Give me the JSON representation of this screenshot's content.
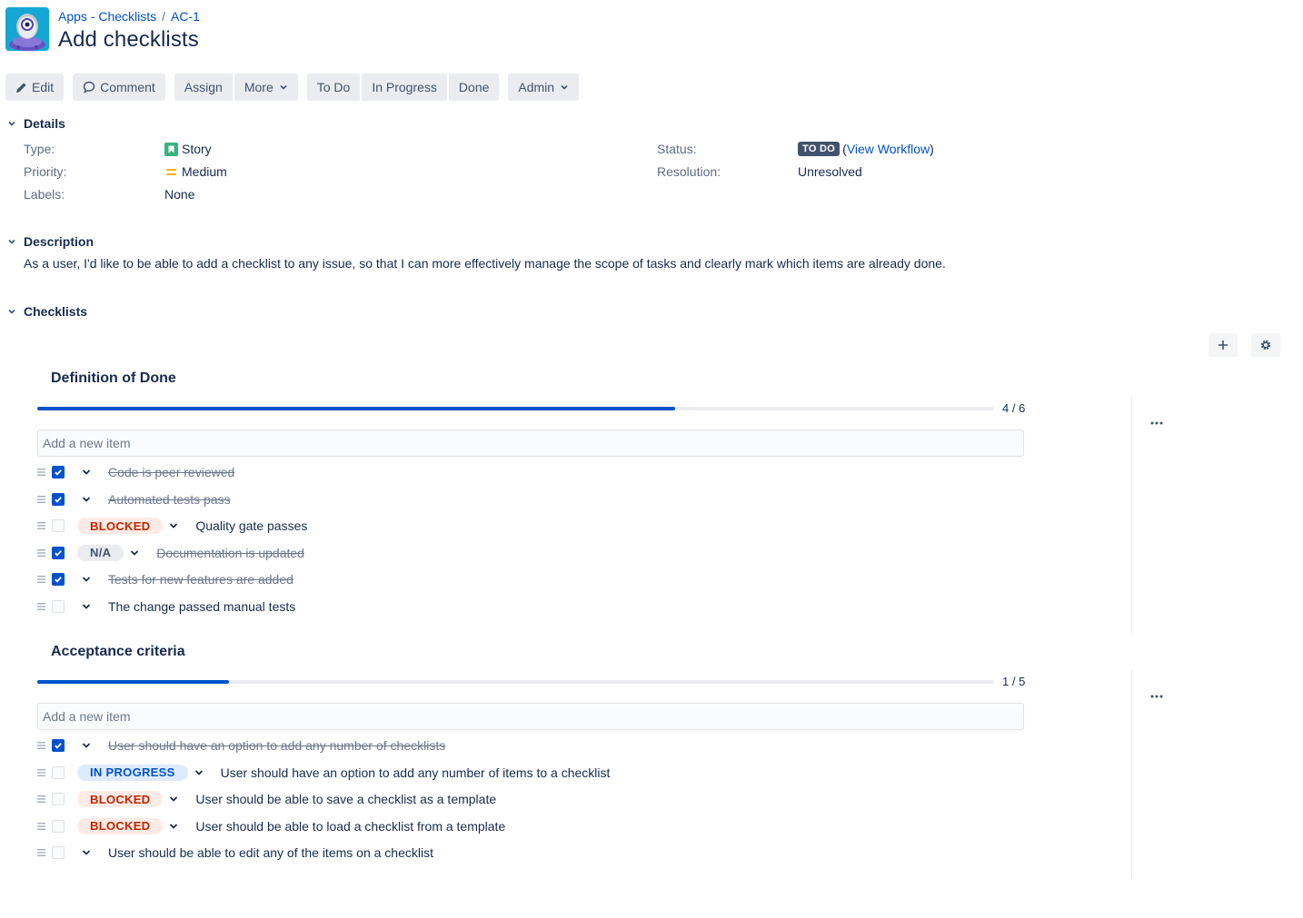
{
  "breadcrumb": {
    "project": "Apps - Checklists",
    "separator": "/",
    "issue_key": "AC-1"
  },
  "issue": {
    "title": "Add checklists"
  },
  "toolbar": {
    "edit": "Edit",
    "comment": "Comment",
    "assign": "Assign",
    "more": "More",
    "todo": "To Do",
    "in_progress": "In Progress",
    "done": "Done",
    "admin": "Admin"
  },
  "details": {
    "heading": "Details",
    "type_label": "Type:",
    "type_value": "Story",
    "priority_label": "Priority:",
    "priority_value": "Medium",
    "labels_label": "Labels:",
    "labels_value": "None",
    "status_label": "Status:",
    "status_value": "TO DO",
    "view_workflow": "View Workflow",
    "resolution_label": "Resolution:",
    "resolution_value": "Unresolved"
  },
  "description": {
    "heading": "Description",
    "text": "As a user, I'd like to be able to add a checklist to any issue, so that I can more effectively manage the scope of tasks and clearly mark which items are already done."
  },
  "checklists_section": {
    "heading": "Checklists"
  },
  "checklists": [
    {
      "title": "Definition of Done",
      "progress": 0.6667,
      "count": "4 / 6",
      "placeholder": "Add a new item",
      "items": [
        {
          "text": "Code is peer reviewed",
          "checked": true,
          "status": ""
        },
        {
          "text": "Automated tests pass",
          "checked": true,
          "status": ""
        },
        {
          "text": "Quality gate passes",
          "checked": false,
          "status": "BLOCKED"
        },
        {
          "text": "Documentation is updated",
          "checked": true,
          "status": "N/A"
        },
        {
          "text": "Tests for new features are added",
          "checked": true,
          "status": ""
        },
        {
          "text": "The change passed manual tests",
          "checked": false,
          "status": ""
        }
      ]
    },
    {
      "title": "Acceptance criteria",
      "progress": 0.2,
      "count": "1 / 5",
      "placeholder": "Add a new item",
      "items": [
        {
          "text": "User should have an option to add any number of checklists",
          "checked": true,
          "status": ""
        },
        {
          "text": "User should have an option to add any number of items to a checklist",
          "checked": false,
          "status": "IN PROGRESS"
        },
        {
          "text": "User should be able to save a checklist as a template",
          "checked": false,
          "status": "BLOCKED"
        },
        {
          "text": "User should be able to load a checklist from a template",
          "checked": false,
          "status": "BLOCKED"
        },
        {
          "text": "User should be able to edit any of the items on a checklist",
          "checked": false,
          "status": ""
        }
      ]
    }
  ],
  "colors": {
    "accent": "#0052cc",
    "blocked": "#bf2600",
    "story": "#36b37e",
    "medium_priority": "#ffab00"
  }
}
